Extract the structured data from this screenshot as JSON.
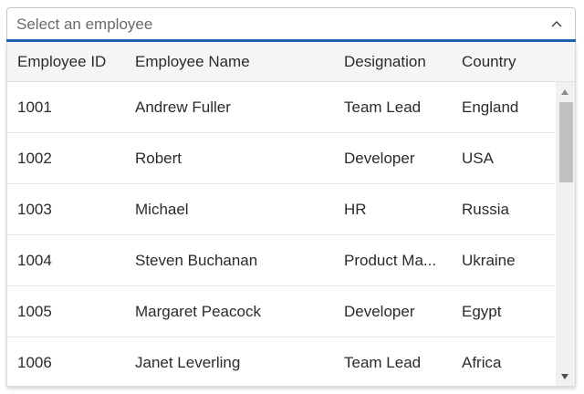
{
  "combo": {
    "placeholder": "Select an employee",
    "value": "",
    "icon": "chevron-up-icon",
    "accent_color": "#1f63b0"
  },
  "grid": {
    "columns": [
      "Employee ID",
      "Employee Name",
      "Designation",
      "Country"
    ],
    "rows": [
      {
        "id": "1001",
        "name": "Andrew Fuller",
        "designation": "Team Lead",
        "country": "England"
      },
      {
        "id": "1002",
        "name": "Robert",
        "designation": "Developer",
        "country": "USA"
      },
      {
        "id": "1003",
        "name": "Michael",
        "designation": "HR",
        "country": "Russia"
      },
      {
        "id": "1004",
        "name": "Steven Buchanan",
        "designation": "Product Ma...",
        "country": "Ukraine"
      },
      {
        "id": "1005",
        "name": "Margaret Peacock",
        "designation": "Developer",
        "country": "Egypt"
      },
      {
        "id": "1006",
        "name": "Janet Leverling",
        "designation": "Team Lead",
        "country": "Africa"
      }
    ]
  }
}
